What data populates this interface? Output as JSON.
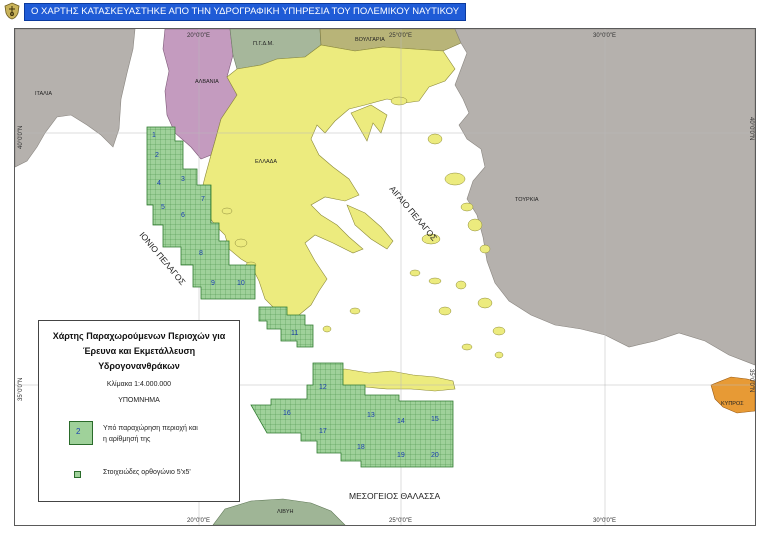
{
  "header": {
    "title": "Ο ΧΑΡΤΗΣ ΚΑΤΑΣΚΕΥΑΣΤΗΚΕ ΑΠΟ ΤΗΝ ΥΔΡΟΓΡΑΦΙΚΗ ΥΠΗΡΕΣΙΑ ΤΟΥ ΠΟΛΕΜΙΚΟΥ ΝΑΥΤΙΚΟΥ",
    "emblem_icon": "navy-emblem-icon"
  },
  "map": {
    "ticks_top": [
      "20°0'0\"E",
      "25°0'0\"E",
      "30°0'0\"E"
    ],
    "ticks_bottom": [
      "20°0'0\"E",
      "25°0'0\"E",
      "30°0'0\"E"
    ],
    "ticks_left": [
      "40°0'0\"N",
      "35°0'0\"N"
    ],
    "ticks_right": [
      "40°0'0\"N",
      "35°0'0\"N"
    ],
    "countries": {
      "italy": "ΙΤΑΛΙΑ",
      "albania": "ΑΛΒΑΝΙΑ",
      "fyrom": "Π.Γ.Δ.Μ.",
      "bulgaria": "ΒΟΥΛΓΑΡΙΑ",
      "greece": "ΕΛΛΑΔΑ",
      "turkey": "ΤΟΥΡΚΙΑ",
      "cyprus": "ΚΥΠΡΟΣ",
      "libya": "ΛΙΒΥΗ"
    },
    "seas": {
      "ionian": "ΙΟΝΙΟ ΠΕΛΑΓΟΣ",
      "aegean": "ΑΙΓΑΙΟ ΠΕΛΑΓΟΣ",
      "mediterranean": "ΜΕΣΟΓΕΙΟΣ ΘΑΛΑΣΣΑ"
    },
    "blocks": [
      "1",
      "2",
      "3",
      "4",
      "5",
      "6",
      "7",
      "8",
      "9",
      "10",
      "11",
      "12",
      "13",
      "14",
      "15",
      "16",
      "17",
      "18",
      "19",
      "20"
    ],
    "colors": {
      "greece": "#eceb7e",
      "albania": "#c49bbf",
      "neighbors": "#b5b1ad",
      "fyrom": "#a6b79b",
      "bulgaria": "#b8b478",
      "cyprus": "#e79a35",
      "libya": "#9fb596",
      "blocks": "#9fd19a",
      "blocks_line": "#2f7a2f",
      "block_number": "#1a3fb0",
      "header_bg": "#1f5bd6"
    }
  },
  "legend": {
    "title_lines": [
      "Χάρτης Παραχωρούμενων Περιοχών για",
      "Έρευνα και Εκμετάλλευση",
      "Υδρογονανθράκων"
    ],
    "scale": "Κλίμακα 1:4.000.000",
    "heading": "ΥΠΟΜΝΗΜΑ",
    "swatch_number": "2",
    "item1_lines": [
      "Υπό παραχώρηση περιοχή και",
      "η αρίθμησή της"
    ],
    "item2": "Στοιχειώδες ορθογώνιο 5'x5'"
  }
}
